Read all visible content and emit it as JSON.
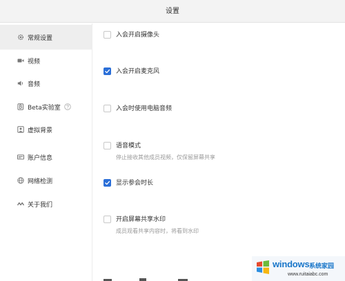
{
  "window": {
    "title": "设置"
  },
  "sidebar": {
    "items": [
      {
        "label": "常规设置",
        "icon": "gear-icon",
        "active": true
      },
      {
        "label": "视频",
        "icon": "video-camera-icon",
        "active": false
      },
      {
        "label": "音频",
        "icon": "speaker-icon",
        "active": false
      },
      {
        "label": "Beta实验室",
        "icon": "beta-lab-icon",
        "active": false,
        "help_icon": "question-circle-icon"
      },
      {
        "label": "虚拟背景",
        "icon": "virtual-background-icon",
        "active": false
      },
      {
        "label": "账户信息",
        "icon": "account-card-icon",
        "active": false
      },
      {
        "label": "网络检测",
        "icon": "globe-icon",
        "active": false
      },
      {
        "label": "关于我们",
        "icon": "logo-icon",
        "active": false
      }
    ]
  },
  "general_settings": {
    "options": [
      {
        "label": "入会开启摄像头",
        "checked": false
      },
      {
        "label": "入会开启麦克风",
        "checked": true
      },
      {
        "label": "入会时使用电脑音频",
        "checked": false
      },
      {
        "label": "语音模式",
        "description": "停止接收其他成员视频，仅保留屏幕共享",
        "checked": false
      },
      {
        "label": "显示参会时长",
        "checked": true
      },
      {
        "label": "开启屏幕共享水印",
        "description": "成员观看共享内容时，将看到水印",
        "checked": false
      }
    ]
  },
  "watermark": {
    "brand": "windows",
    "brand_cn": "系统家园",
    "url": "www.ruitaiabc.com"
  },
  "colors": {
    "accent": "#2b6fd8",
    "sidebar_active_bg": "#eeeeee",
    "titlebar_bg": "#f3f3f3"
  }
}
